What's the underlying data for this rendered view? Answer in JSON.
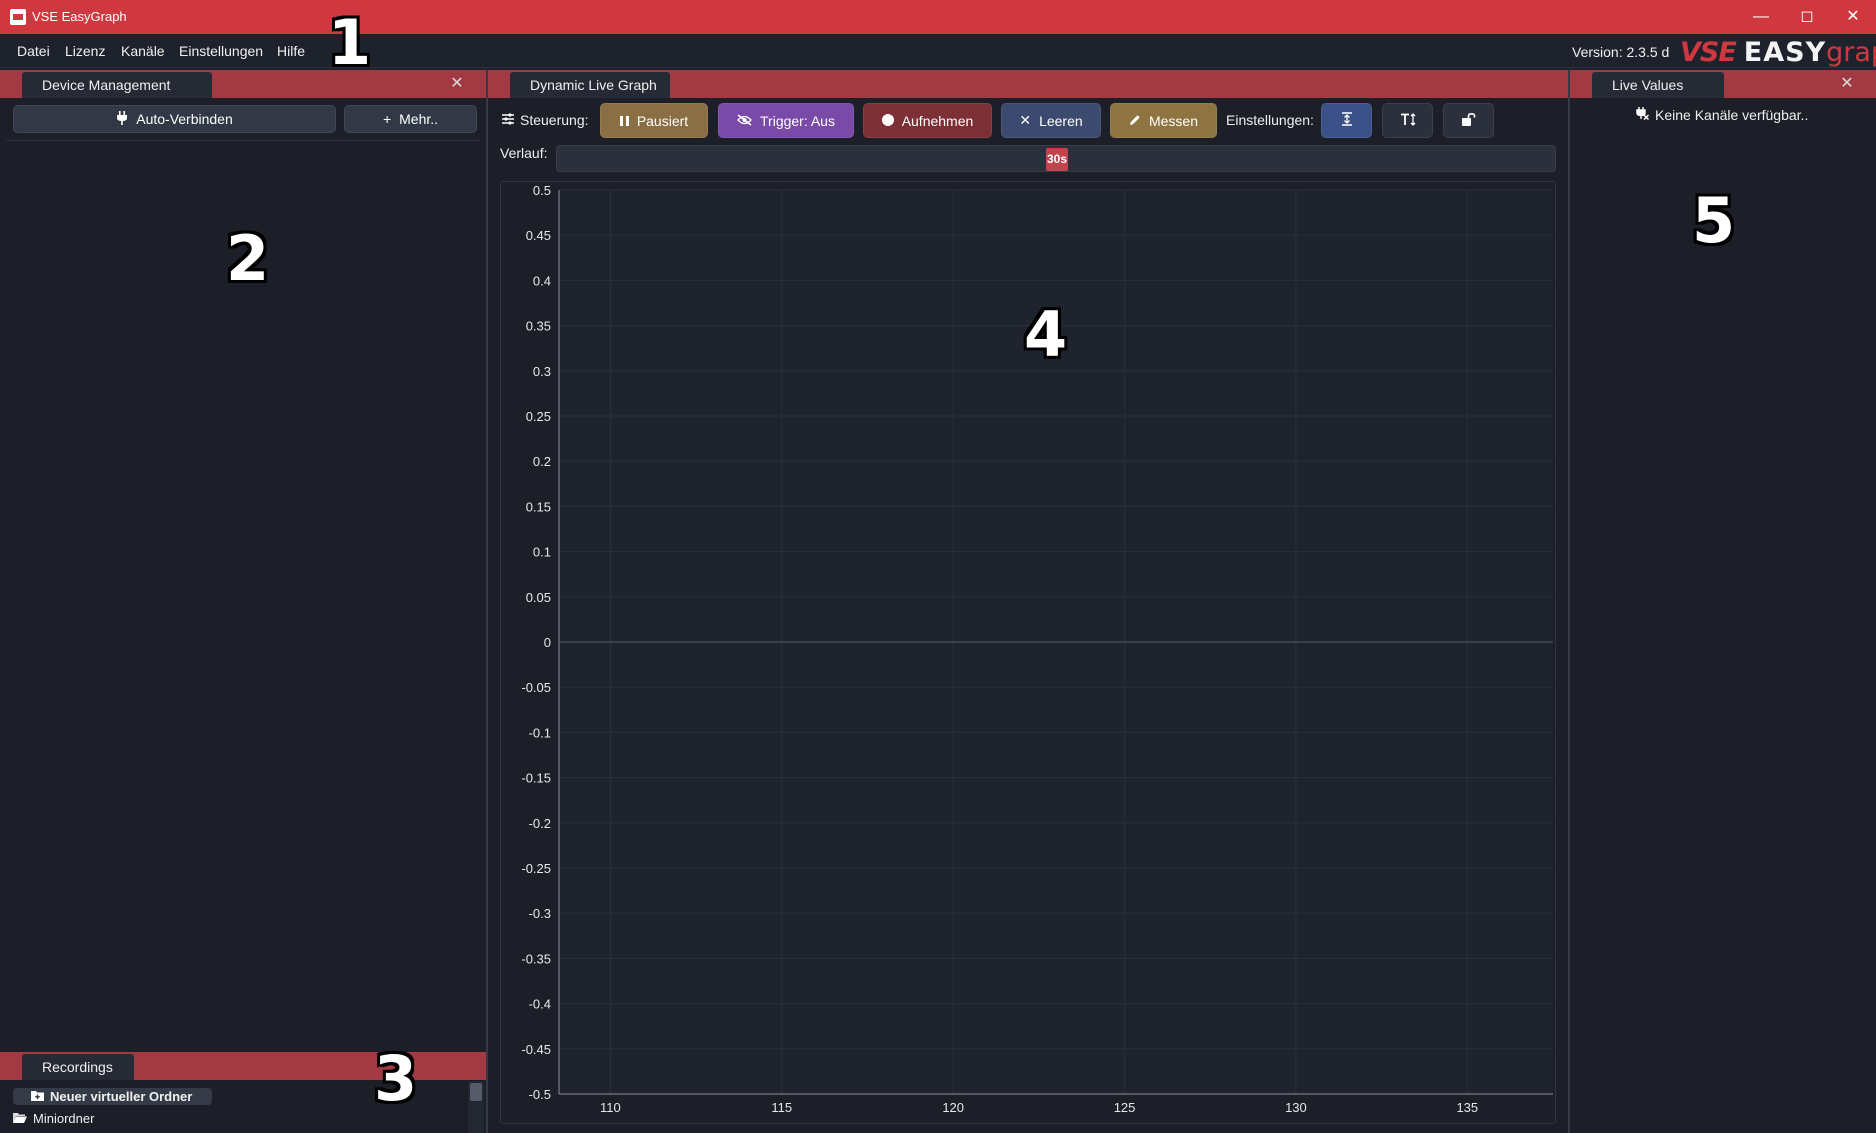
{
  "window": {
    "title": "VSE EasyGraph"
  },
  "menu": {
    "items": [
      "Datei",
      "Lizenz",
      "Kanäle",
      "Einstellungen",
      "Hilfe"
    ]
  },
  "version": "Version: 2.3.5 d",
  "brand": {
    "vse": "VSE",
    "easy": "EASY",
    "graph": "graph"
  },
  "device_panel": {
    "tab": "Device Management",
    "auto_connect": "Auto-Verbinden",
    "more": "Mehr.."
  },
  "recordings_panel": {
    "tab": "Recordings",
    "new_folder": "Neuer virtueller Ordner",
    "items": [
      "Miniordner"
    ]
  },
  "graph_panel": {
    "tab": "Dynamic Live Graph",
    "control_label": "Steuerung:",
    "buttons": {
      "pause": "Pausiert",
      "trigger": "Trigger: Aus",
      "record": "Aufnehmen",
      "clear": "Leeren",
      "measure": "Messen"
    },
    "settings_label": "Einstellungen:",
    "history_label": "Verlauf:",
    "history_value": "30s"
  },
  "live_values_panel": {
    "tab": "Live Values",
    "empty_message": "Keine Kanäle verfügbar.."
  },
  "annotations": [
    "1",
    "2",
    "3",
    "4",
    "5"
  ],
  "chart_data": {
    "type": "line",
    "title": "",
    "xlabel": "",
    "ylabel": "",
    "xlim": [
      108.5,
      137.5
    ],
    "ylim": [
      -0.5,
      0.5
    ],
    "x_ticks": [
      110,
      115,
      120,
      125,
      130,
      135
    ],
    "y_ticks": [
      0.5,
      0.45,
      0.4,
      0.35,
      0.3,
      0.25,
      0.2,
      0.15,
      0.1,
      0.05,
      0,
      -0.05,
      -0.1,
      -0.15,
      -0.2,
      -0.25,
      -0.3,
      -0.35,
      -0.4,
      -0.45,
      -0.5
    ],
    "series": [],
    "grid": true
  },
  "colors": {
    "accent": "#d0383f",
    "panel_header": "#a33a43",
    "background": "#1c1f28"
  }
}
